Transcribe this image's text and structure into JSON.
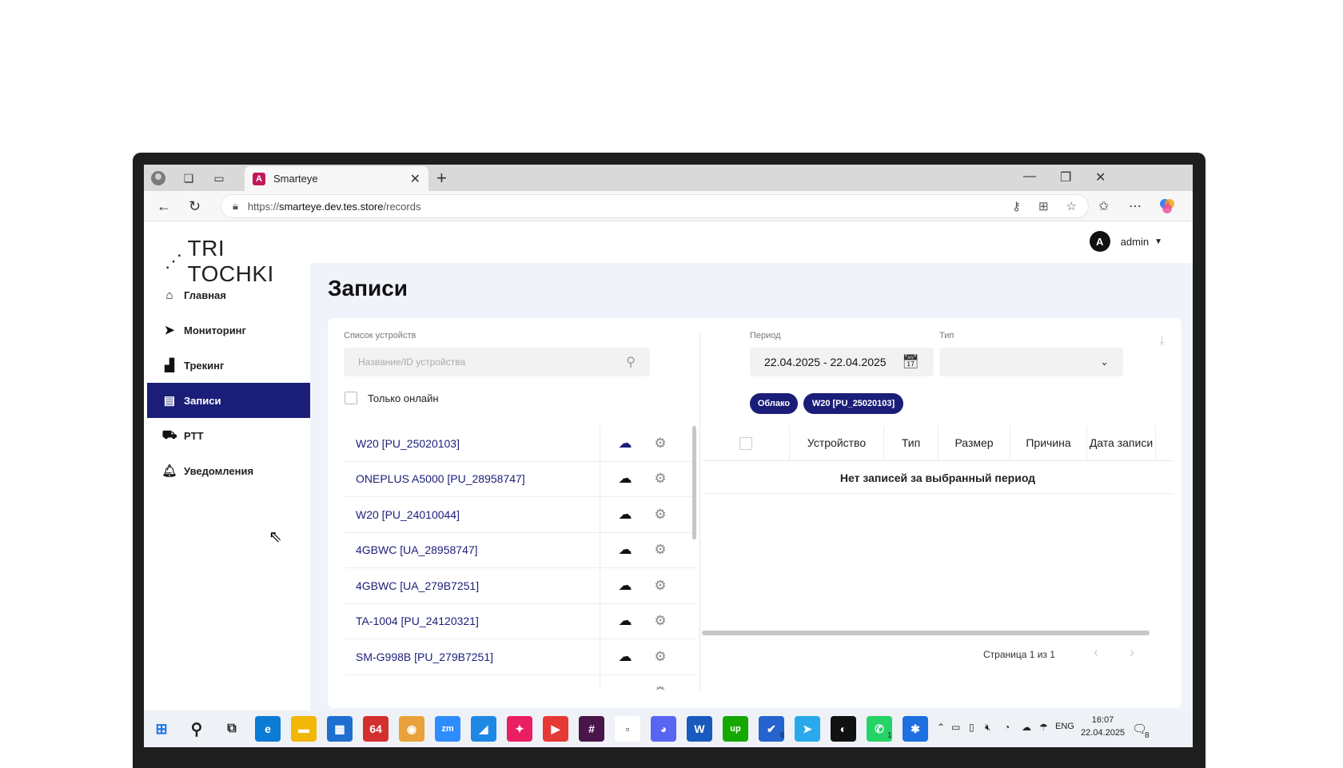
{
  "browser": {
    "tab_title": "Smarteye",
    "url_prefix": "https://",
    "url_host": "smarteye.dev.tes.store",
    "url_path": "/records"
  },
  "app": {
    "logo_text": "TRI TOCHKI",
    "user": {
      "avatar_letter": "A",
      "name": "admin"
    },
    "menu": [
      {
        "label": "Главная",
        "icon": "home-icon",
        "active": false
      },
      {
        "label": "Мониторинг",
        "icon": "navigation-arrow-icon",
        "active": false
      },
      {
        "label": "Трекинг",
        "icon": "bar-chart-icon",
        "active": false
      },
      {
        "label": "Записи",
        "icon": "document-icon",
        "active": true
      },
      {
        "label": "PTT",
        "icon": "car-icon",
        "active": false
      },
      {
        "label": "Уведомления",
        "icon": "bell-icon",
        "active": false
      }
    ],
    "page_title": "Записи",
    "filters": {
      "devices_label": "Список устройств",
      "search_placeholder": "Название/ID устройства",
      "online_only_label": "Только онлайн",
      "period_label": "Период",
      "period_value": "22.04.2025 - 22.04.2025",
      "type_label": "Тип",
      "type_value": ""
    },
    "chips": [
      "Облако",
      "W20 [PU_25020103]"
    ],
    "devices": [
      {
        "name": "W20 [PU_25020103]",
        "cloud_active": true
      },
      {
        "name": "ONEPLUS A5000 [PU_28958747]",
        "cloud_active": false
      },
      {
        "name": "W20 [PU_24010044]",
        "cloud_active": false
      },
      {
        "name": "4GBWC [UA_28958747]",
        "cloud_active": false
      },
      {
        "name": "4GBWC [UA_279B7251]",
        "cloud_active": false
      },
      {
        "name": "TA-1004 [PU_24120321]",
        "cloud_active": false
      },
      {
        "name": "SM-G998B [PU_279B7251]",
        "cloud_active": false
      }
    ],
    "table": {
      "columns": [
        "Устройство",
        "Тип",
        "Размер",
        "Причина",
        "Дата записи"
      ],
      "empty_text": "Нет записей за выбранный период",
      "pager_text": "Страница 1 из 1"
    }
  },
  "taskbar": {
    "badges": {
      "todo": "6",
      "whatsapp": "1"
    },
    "lang": "ENG",
    "time": "16:07",
    "date": "22.04.2025",
    "notifications": "8"
  },
  "colors": {
    "accent": "#1b1e78"
  }
}
